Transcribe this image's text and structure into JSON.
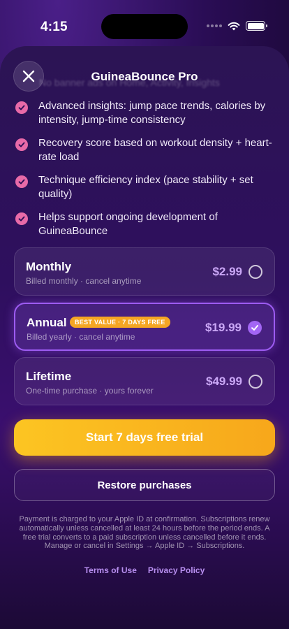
{
  "status_bar": {
    "time": "4:15"
  },
  "sheet": {
    "title": "GuineaBounce Pro",
    "faded_feature": "No banner ads on Home, Activity, Insights"
  },
  "features": [
    {
      "text": "Advanced insights: jump pace trends, calories by intensity, jump-time consistency"
    },
    {
      "text": "Recovery score based on workout density + heart-rate load"
    },
    {
      "text": "Technique efficiency index (pace stability + set quality)"
    },
    {
      "text": "Helps support ongoing development of GuineaBounce"
    }
  ],
  "plans": [
    {
      "name": "Monthly",
      "subtitle": "Billed monthly · cancel anytime",
      "price": "$2.99",
      "selected": false
    },
    {
      "name": "Annual",
      "badge": "BEST VALUE · 7 DAYS FREE",
      "subtitle": "Billed yearly · cancel anytime",
      "price": "$19.99",
      "selected": true
    },
    {
      "name": "Lifetime",
      "subtitle": "One-time purchase · yours forever",
      "price": "$49.99",
      "selected": false
    }
  ],
  "cta_label": "Start 7 days free trial",
  "restore_label": "Restore purchases",
  "disclaimer": "Payment is charged to your Apple ID at confirmation. Subscriptions renew automatically unless cancelled at least 24 hours before the period ends. A free trial converts to a paid subscription unless cancelled before it ends. Manage or cancel in Settings → Apple ID → Subscriptions.",
  "links": {
    "terms": "Terms of Use",
    "privacy": "Privacy Policy"
  },
  "colors": {
    "accent_purple": "#9d5cf2",
    "price_purple": "#c9a6f5",
    "check_pink": "#e86aa8",
    "cta_yellow": "#fcc522",
    "badge_orange": "#f5a623"
  }
}
